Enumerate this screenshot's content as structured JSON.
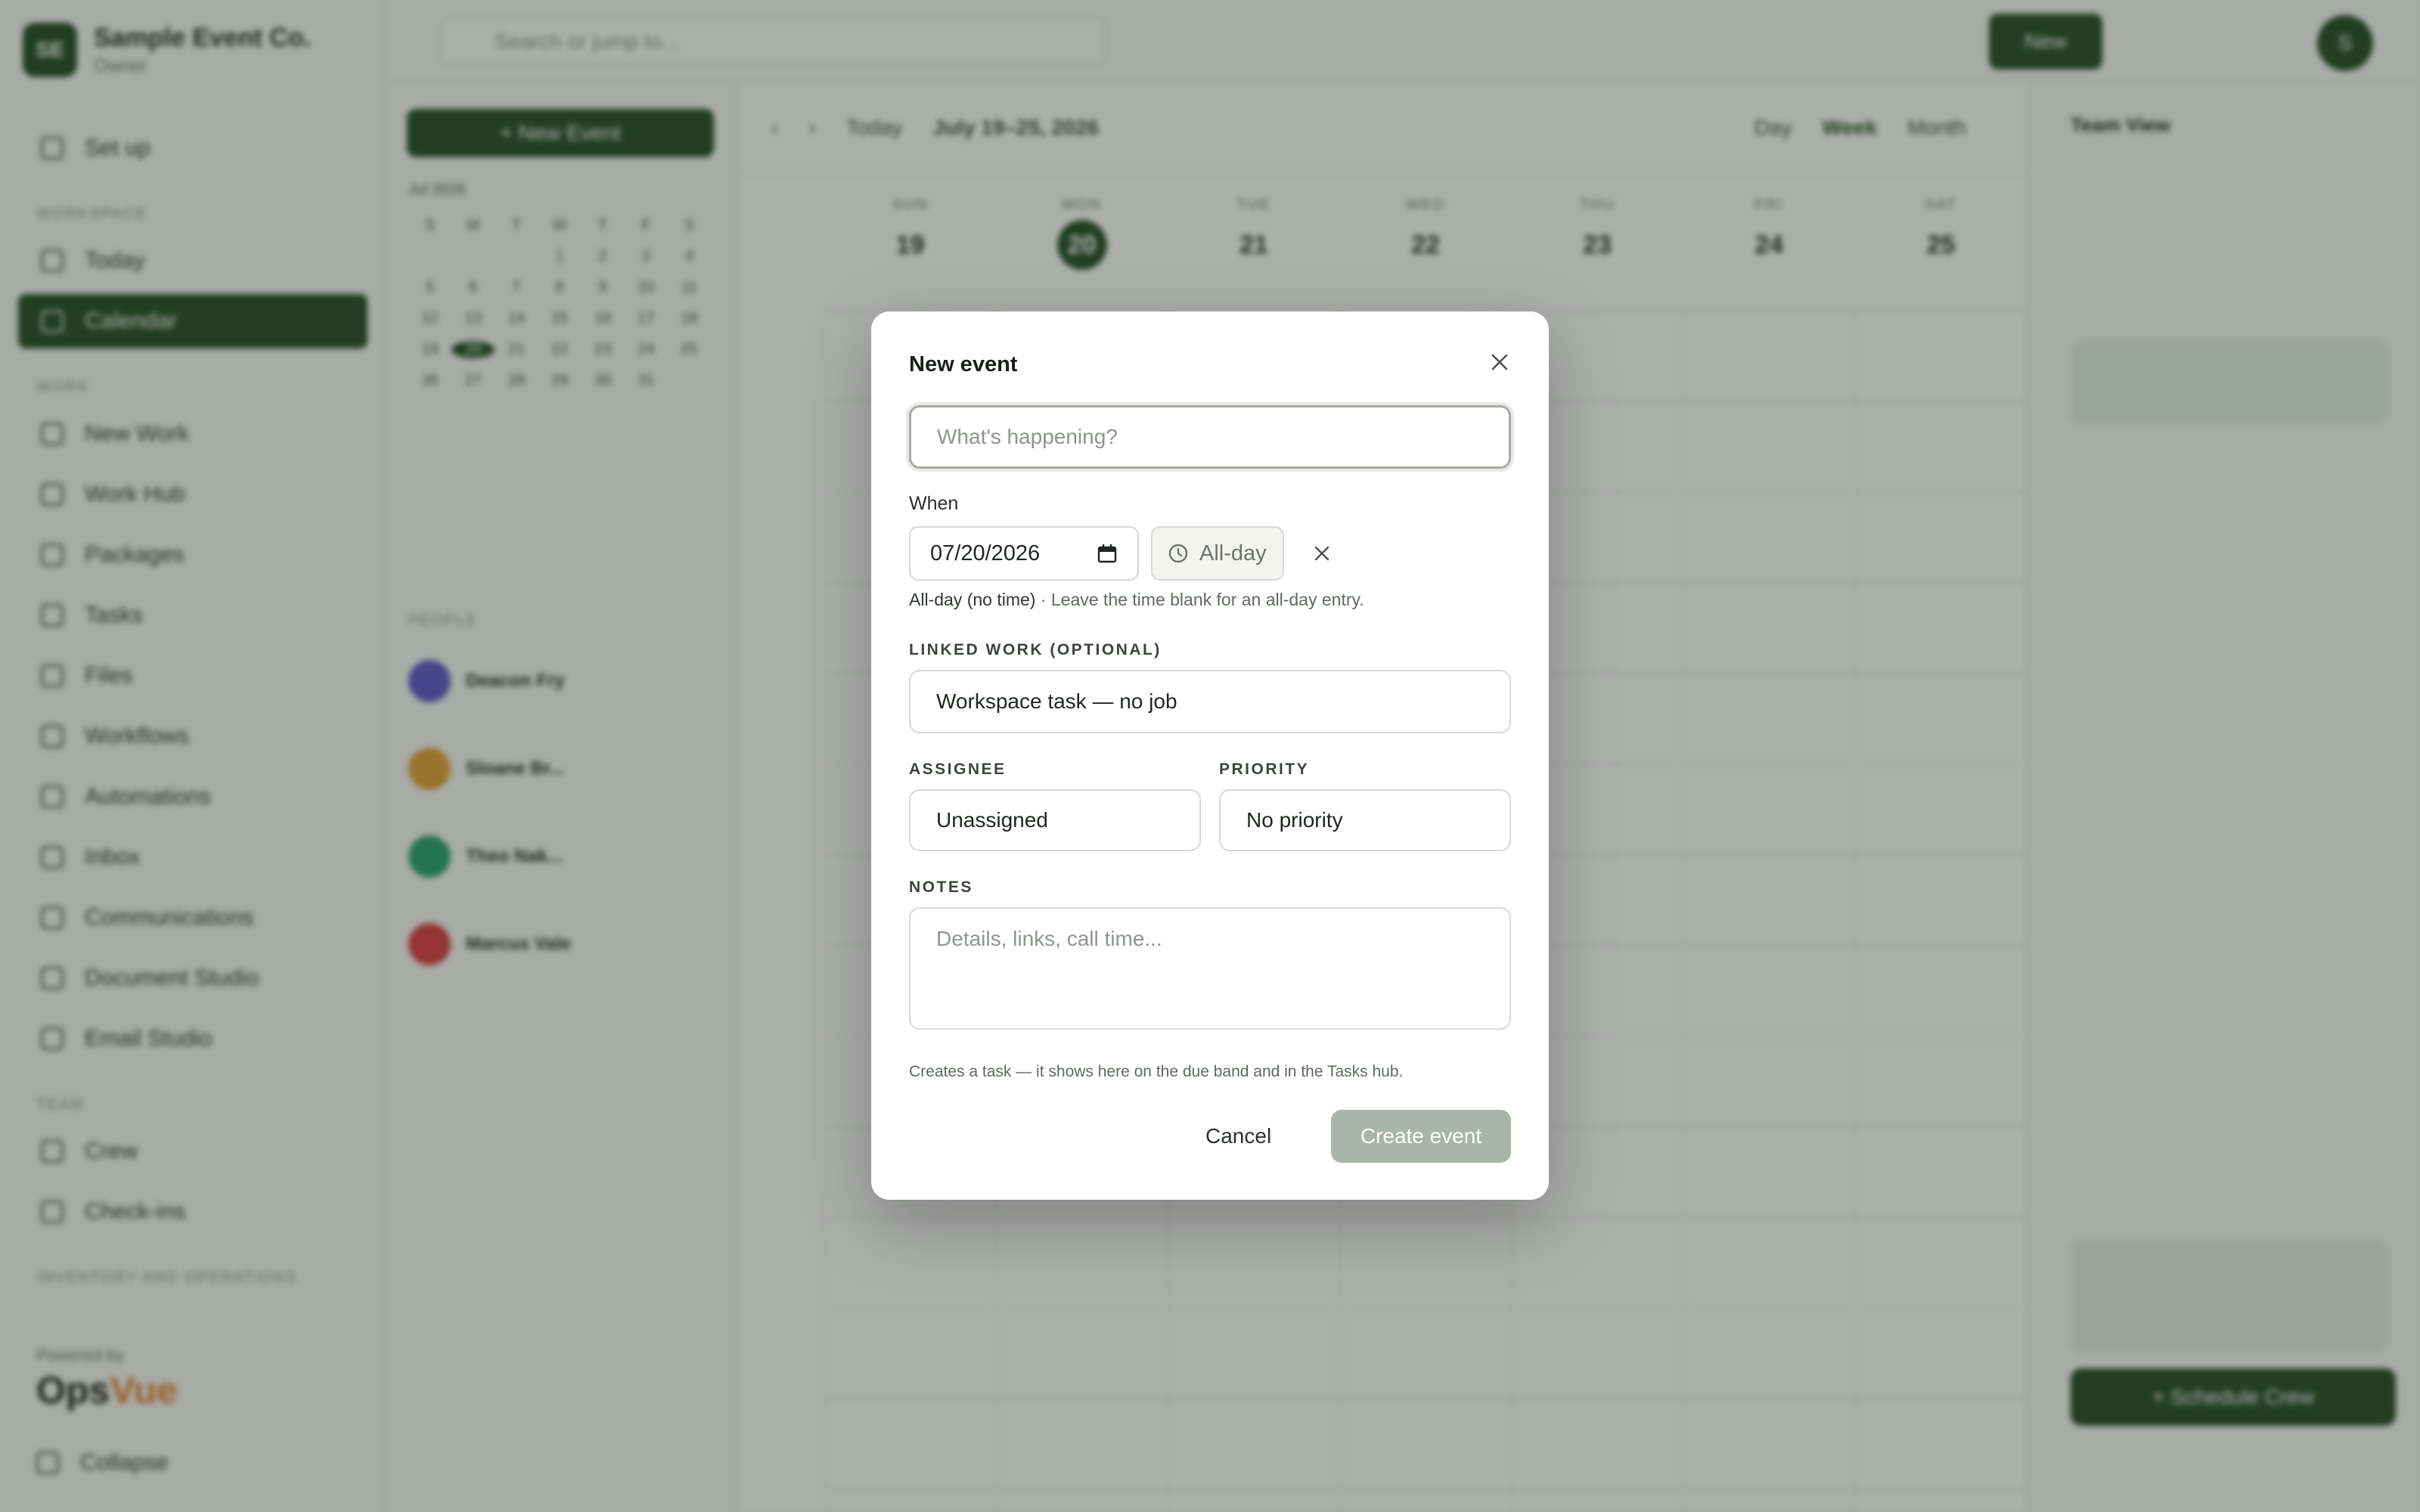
{
  "app": {
    "brand_initials": "SE",
    "brand_name": "Sample Event Co.",
    "brand_sub": "Owner",
    "search_placeholder": "Search or jump to...",
    "new_label": "New",
    "avatar_initial": "S",
    "nav": [
      {
        "label": "Set up"
      },
      {
        "label": "Today"
      },
      {
        "label": "Calendar"
      },
      {
        "label": "New Work"
      },
      {
        "label": "Work Hub"
      },
      {
        "label": "Packages"
      },
      {
        "label": "Tasks"
      },
      {
        "label": "Files"
      },
      {
        "label": "Workflows"
      },
      {
        "label": "Automations"
      },
      {
        "label": "Inbox"
      },
      {
        "label": "Communications"
      },
      {
        "label": "Document Studio"
      },
      {
        "label": "Email Studio"
      },
      {
        "label": "Crew"
      },
      {
        "label": "Check-ins"
      }
    ],
    "nav_sections": [
      "WORKSPACE",
      "WORK",
      "TEAM",
      "INVENTORY AND OPERATIONS"
    ],
    "powered_by": "Powered by",
    "powered_brand_a": "Ops",
    "powered_brand_b": "Vue",
    "collapse": "Collapse",
    "new_event_btn": "+ New Event",
    "minical_month": "Jul 2026",
    "calendar_today": "Today",
    "calendar_range": "July 19–25, 2026",
    "view_day": "Day",
    "view_week": "Week",
    "view_month": "Month",
    "week_days": [
      {
        "l": "SUN",
        "n": "19"
      },
      {
        "l": "MON",
        "n": "20"
      },
      {
        "l": "TUE",
        "n": "21"
      },
      {
        "l": "WED",
        "n": "22"
      },
      {
        "l": "THU",
        "n": "23"
      },
      {
        "l": "FRI",
        "n": "24"
      },
      {
        "l": "SAT",
        "n": "25"
      }
    ],
    "people_title": "PEOPLE",
    "people": [
      {
        "name": "Deacon Fry",
        "color": "#5b55c9"
      },
      {
        "name": "Sloane Br...",
        "color": "#e0a030"
      },
      {
        "name": "Theo Nak...",
        "color": "#24a06b"
      },
      {
        "name": "Marcus Vale",
        "color": "#d83a3a"
      }
    ],
    "team_view": "Team View",
    "schedule_label": "+ Schedule Crew"
  },
  "modal": {
    "title": "New event",
    "title_placeholder": "What's happening?",
    "when_label": "When",
    "date_value": "07/20/2026",
    "allday_button": "All-day",
    "allday_hint_strong": "All-day (no time)",
    "allday_hint_rest": " · Leave the time blank for an all-day entry.",
    "linked_label": "LINKED WORK (OPTIONAL)",
    "linked_value": "Workspace task — no job",
    "assignee_label": "ASSIGNEE",
    "assignee_value": "Unassigned",
    "priority_label": "PRIORITY",
    "priority_value": "No priority",
    "notes_label": "NOTES",
    "notes_placeholder": "Details, links, call time...",
    "footnote": "Creates a task — it shows here on the due band and in the Tasks hub.",
    "cancel": "Cancel",
    "create": "Create event"
  },
  "colors": {
    "brand_green": "#1d4a1d",
    "create_disabled": "#a9b5a8"
  }
}
